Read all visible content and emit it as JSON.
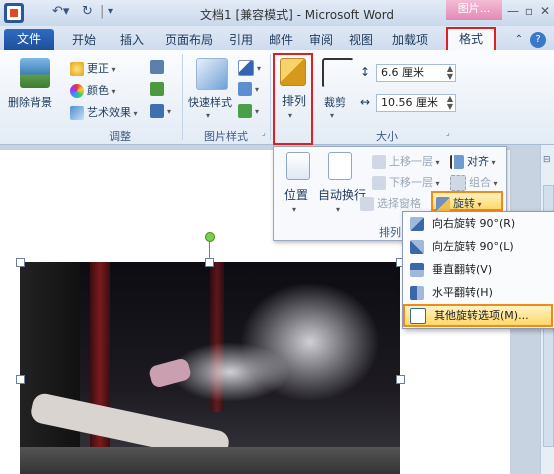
{
  "window": {
    "title": "文档1 [兼容模式] - Microsoft Word",
    "context_tab": "图片...",
    "buttons": [
      "minimize",
      "maximize",
      "close"
    ]
  },
  "tabs": [
    "文件",
    "开始",
    "插入",
    "页面布局",
    "引用",
    "邮件",
    "审阅",
    "视图",
    "加载项",
    "格式"
  ],
  "ribbon": {
    "remove_bg": "删除背景",
    "adjust": {
      "corrections": "更正",
      "color": "颜色",
      "artistic": "艺术效果",
      "label": "调整"
    },
    "picture_styles": {
      "quick_styles": "快速样式",
      "label": "图片样式"
    },
    "arrange": "排列",
    "crop": "裁剪",
    "size": {
      "height": "6.6 厘米",
      "width": "10.56 厘米",
      "label": "大小"
    }
  },
  "arrange_panel": {
    "position": "位置",
    "wrap": "自动换行",
    "bring_forward": "上移一层",
    "send_backward": "下移一层",
    "selection_pane": "选择窗格",
    "align": "对齐",
    "group": "组合",
    "rotate": "旋转",
    "label": "排列"
  },
  "rotate_menu": [
    "向右旋转 90°(R)",
    "向左旋转 90°(L)",
    "垂直翻转(V)",
    "水平翻转(H)",
    "其他旋转选项(M)..."
  ],
  "colors": {
    "accent": "#1f4f9a",
    "highlight": "#e02020",
    "context": "#e28ab4"
  }
}
